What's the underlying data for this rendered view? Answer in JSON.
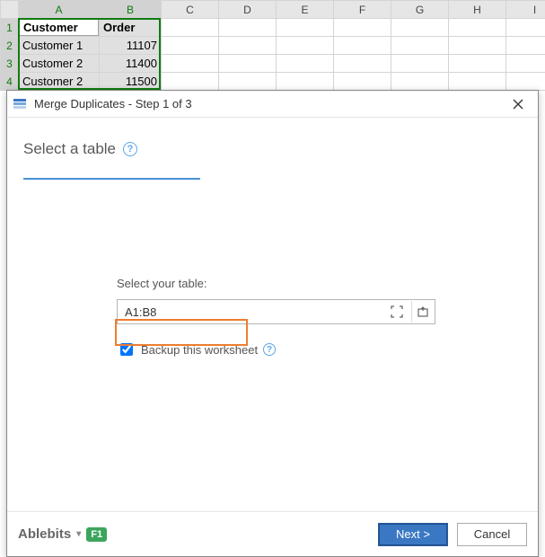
{
  "sheet": {
    "columns": [
      "A",
      "B",
      "C",
      "D",
      "E",
      "F",
      "G",
      "H",
      "I"
    ],
    "rows": [
      "1",
      "2",
      "3",
      "4"
    ],
    "headers": {
      "A": "Customer",
      "B": "Order"
    },
    "data": [
      {
        "A": "Customer 1",
        "B": "11107"
      },
      {
        "A": "Customer 2",
        "B": "11400"
      },
      {
        "A": "Customer 2",
        "B": "11500"
      }
    ],
    "selected_range": "A1:B4",
    "active_cell": "A1"
  },
  "dialog": {
    "icon": "merge-duplicates-icon",
    "title": "Merge Duplicates - Step 1 of 3",
    "heading": "Select a table",
    "form": {
      "table_label": "Select your table:",
      "range_value": "A1:B8",
      "backup_checked": true,
      "backup_label": "Backup this worksheet"
    },
    "footer": {
      "brand": "Ablebits",
      "f1": "F1",
      "next": "Next >",
      "cancel": "Cancel"
    }
  }
}
